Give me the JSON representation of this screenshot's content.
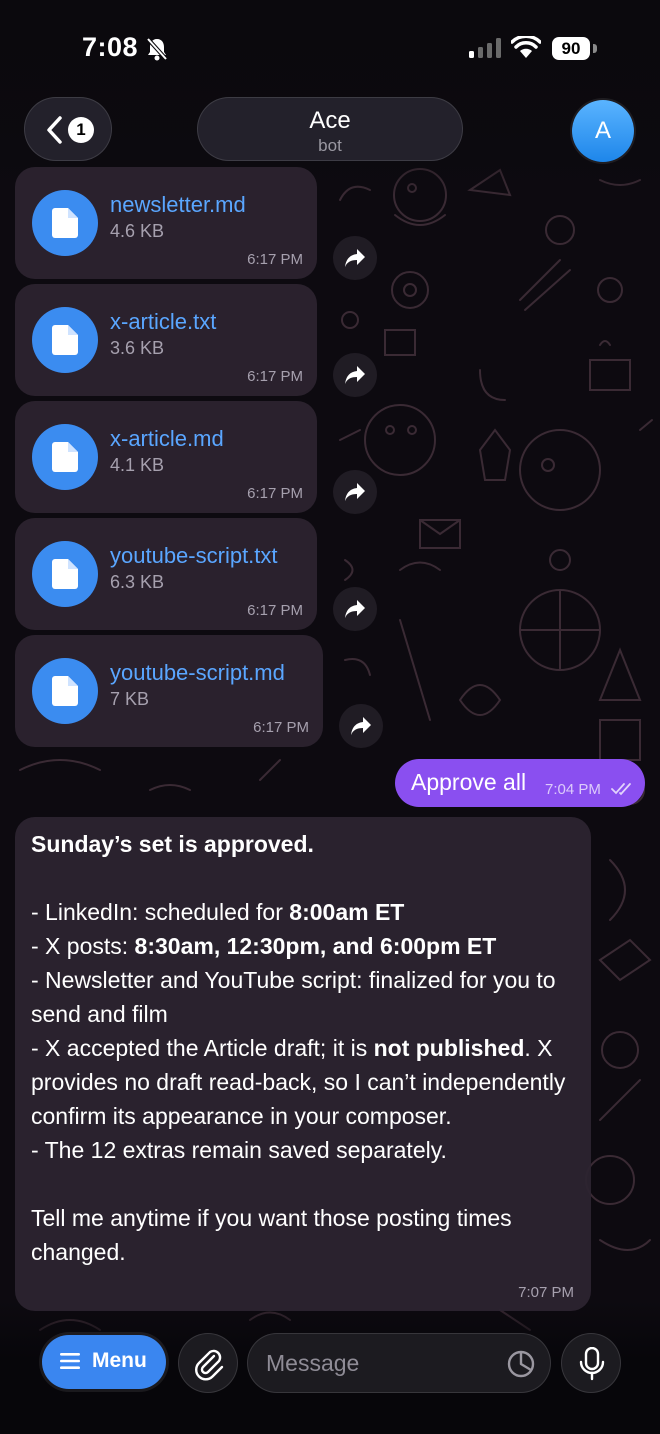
{
  "status_bar": {
    "time": "7:08",
    "battery": "90"
  },
  "header": {
    "back_badge": "1",
    "title": "Ace",
    "subtitle": "bot",
    "avatar_letter": "A"
  },
  "files": [
    {
      "name": "newsletter.md",
      "size": "4.6 KB",
      "time": "6:17 PM",
      "icon": "file-icon"
    },
    {
      "name": "x-article.txt",
      "size": "3.6 KB",
      "time": "6:17 PM",
      "icon": "file-icon"
    },
    {
      "name": "x-article.md",
      "size": "4.1 KB",
      "time": "6:17 PM",
      "icon": "file-icon"
    },
    {
      "name": "youtube-script.txt",
      "size": "6.3 KB",
      "time": "6:17 PM",
      "icon": "file-icon"
    },
    {
      "name": "youtube-script.md",
      "size": "7 KB",
      "time": "6:17 PM",
      "icon": "file-icon"
    }
  ],
  "outgoing": {
    "text": "Approve all",
    "time": "7:04 PM"
  },
  "incoming": {
    "heading": "Sunday’s set is approved.",
    "linkedin_prefix": "- LinkedIn: scheduled for ",
    "linkedin_time": "8:00am ET",
    "x_posts_prefix": "- X posts: ",
    "x_posts_times": "8:30am, 12:30pm, and 6:00pm ET",
    "newsletter_line": "- Newsletter and YouTube script: finalized for you to send and film",
    "article_prefix": "- X accepted the Article draft; it is ",
    "article_bold": "not published",
    "article_suffix": ". X provides no draft read-back, so I can’t independently confirm its appearance in your composer.",
    "extras_line": "- The 12 extras remain saved separately.",
    "closing": "Tell me anytime if you want those posting times changed.",
    "time": "7:07 PM"
  },
  "input_bar": {
    "menu_label": "Menu",
    "placeholder": "Message"
  },
  "colors": {
    "accent_blue": "#3a86f0",
    "link_blue": "#5aa6ff",
    "outgoing_purple": "#8a4ff0",
    "bubble": "#2c2430"
  }
}
